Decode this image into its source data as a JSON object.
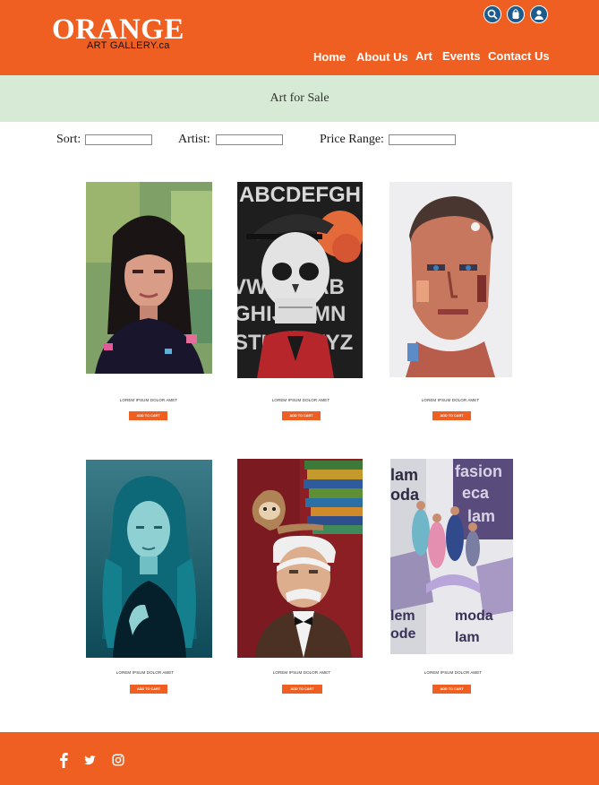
{
  "brand": {
    "name": "ORANGE",
    "tagline": "ART GALLERY.ca"
  },
  "header_icons": [
    "search-icon",
    "shopping-bag-icon",
    "user-icon"
  ],
  "nav": [
    {
      "label": "Home"
    },
    {
      "label": "About Us"
    },
    {
      "label": "Art"
    },
    {
      "label": "Events"
    },
    {
      "label": "Contact Us"
    }
  ],
  "page": {
    "title": "Art for Sale"
  },
  "filters": {
    "sort_label": "Sort:",
    "artist_label": "Artist:",
    "price_label": "Price Range:"
  },
  "products": [
    {
      "caption": "LOREM IPSUM DOLOR AMET",
      "button": "ADD TO CART",
      "art": "girl-portrait"
    },
    {
      "caption": "LOREM IPSUM DOLOR AMET",
      "button": "ADD TO CART",
      "art": "skull-flowers"
    },
    {
      "caption": "LOREM IPSUM DOLOR AMET",
      "button": "ADD TO CART",
      "art": "man-portrait"
    },
    {
      "caption": "LOREM IPSUM DOLOR AMET",
      "button": "ADD TO CART",
      "art": "woman-teal"
    },
    {
      "caption": "LOREM IPSUM DOLOR AMET",
      "button": "ADD TO CART",
      "art": "monkey-writer"
    },
    {
      "caption": "LOREM IPSUM DOLOR AMET",
      "button": "ADD TO CART",
      "art": "fashion-collage"
    }
  ],
  "social": [
    "facebook-icon",
    "twitter-icon",
    "instagram-icon"
  ],
  "colors": {
    "brand": "#ef5f22",
    "subbar": "#d6ead5",
    "icon_fill": "#1d5b8c"
  }
}
